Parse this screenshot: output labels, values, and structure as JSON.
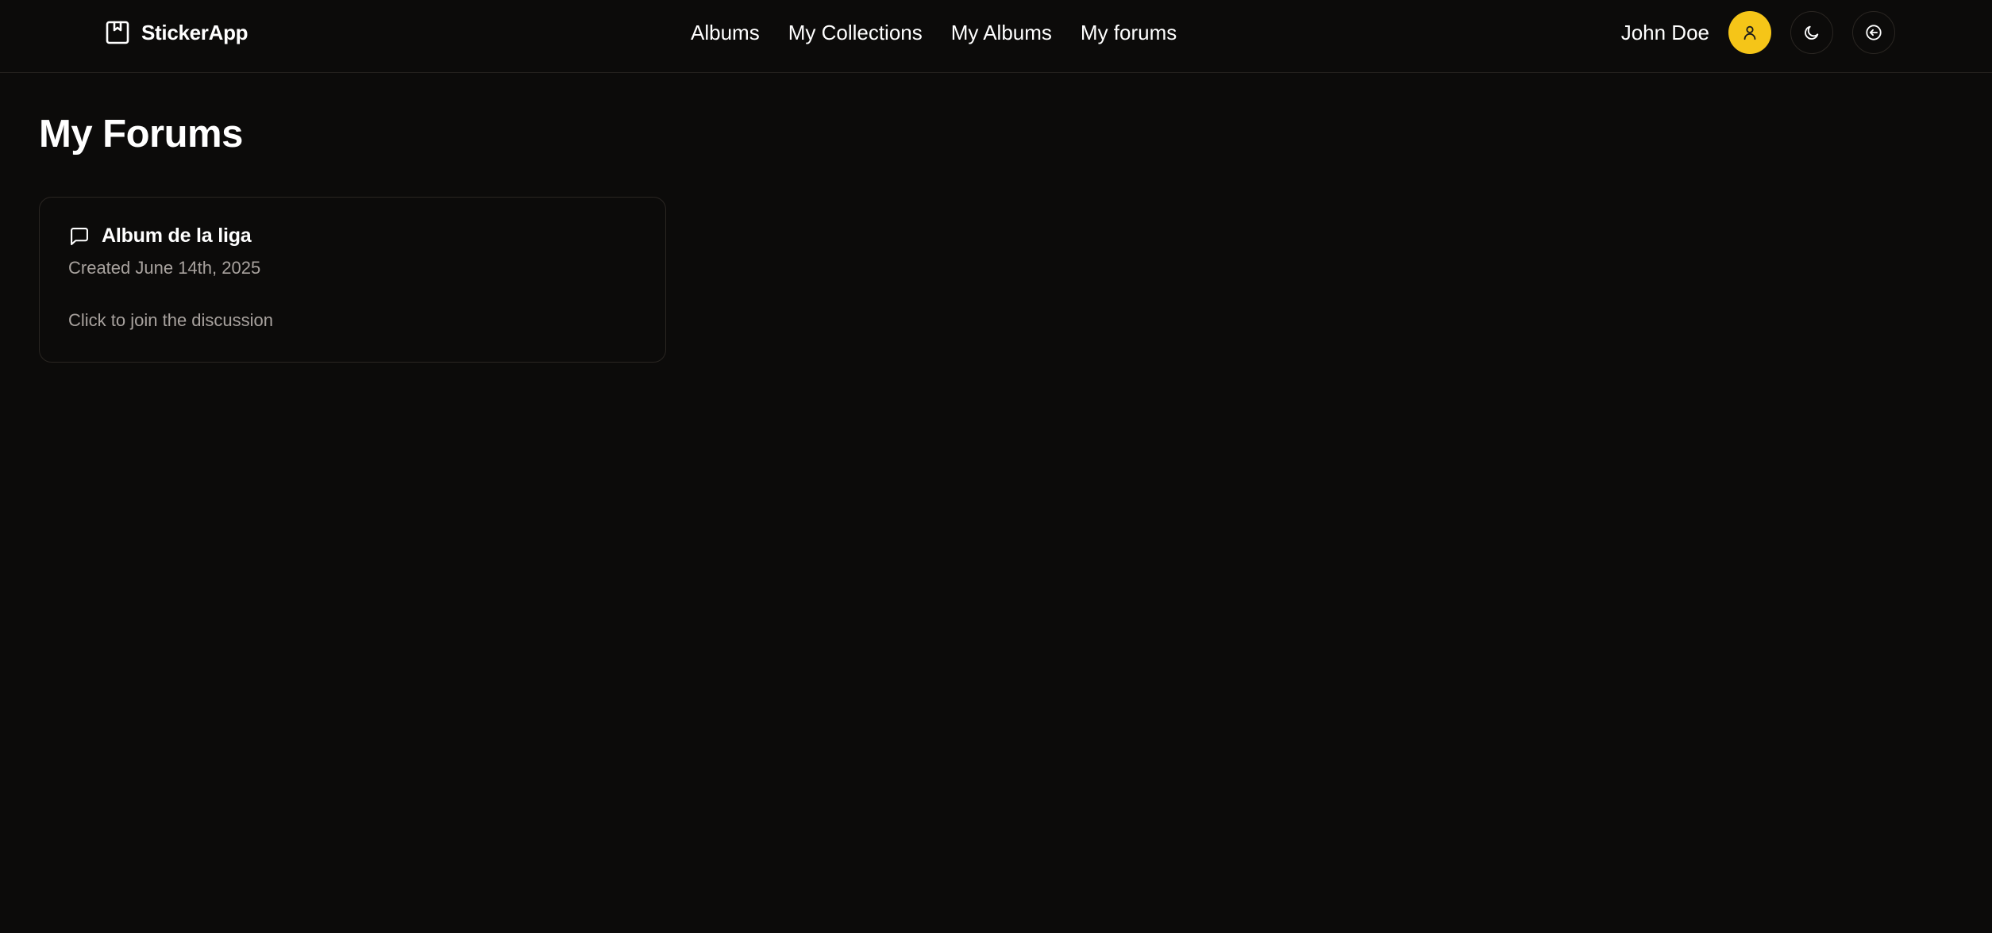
{
  "navbar": {
    "brand": {
      "icon": "sticker-book-icon",
      "name": "StickerApp"
    },
    "links": [
      {
        "label": "Albums"
      },
      {
        "label": "My Collections"
      },
      {
        "label": "My Albums"
      },
      {
        "label": "My forums"
      }
    ],
    "user": {
      "name": "John Doe",
      "avatar_icon": "user-icon",
      "avatar_color": "#f5c518"
    },
    "actions": [
      {
        "icon": "moon-icon"
      },
      {
        "icon": "arrow-left-circle-icon"
      }
    ]
  },
  "main": {
    "title": "My Forums",
    "forums": [
      {
        "icon": "message-square-icon",
        "title": "Album de la liga",
        "created": "Created June 14th, 2025",
        "cta": "Click to join the discussion"
      }
    ]
  },
  "colors": {
    "background": "#0c0b0a",
    "accent": "#f5c518",
    "muted_text": "#a8a29e",
    "border": "#2a2622"
  }
}
